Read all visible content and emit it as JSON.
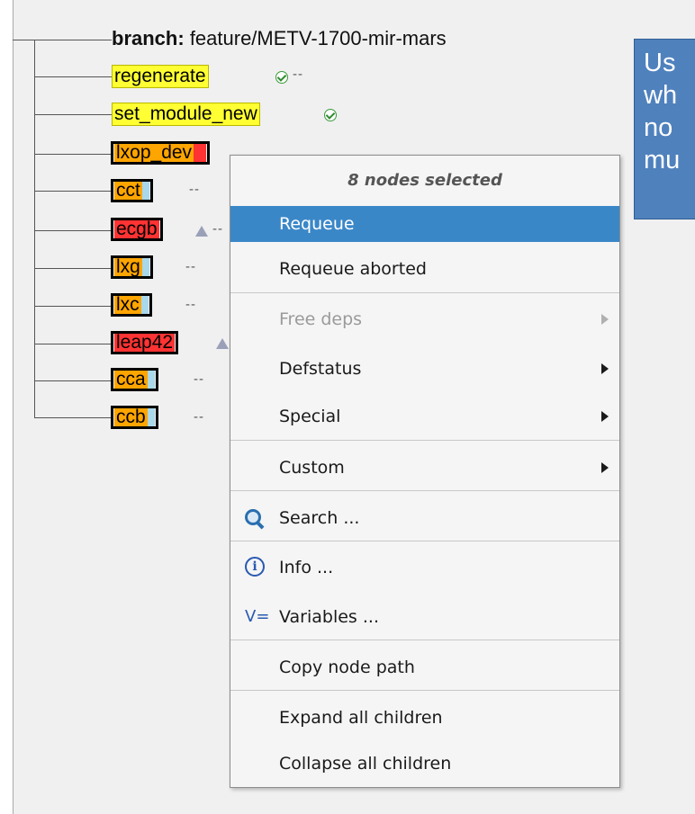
{
  "tree": {
    "branch_key": "branch:",
    "branch_value": "feature/METV-1700-mir-mars",
    "nodes": [
      {
        "label": "regenerate",
        "style": "yellow"
      },
      {
        "label": "set_module_new",
        "style": "yellow"
      },
      {
        "label": "lxop_dev",
        "style": "orange"
      },
      {
        "label": "cct",
        "style": "orange"
      },
      {
        "label": "ecgb",
        "style": "red"
      },
      {
        "label": "lxg",
        "style": "orange"
      },
      {
        "label": "lxc",
        "style": "orange"
      },
      {
        "label": "leap42",
        "style": "red"
      },
      {
        "label": "cca",
        "style": "orange"
      },
      {
        "label": "ccb",
        "style": "orange"
      }
    ],
    "dashes": "--"
  },
  "tooltip": {
    "lines": [
      "Us",
      "wh",
      "no",
      "mu"
    ]
  },
  "context_menu": {
    "header": "8 nodes selected",
    "items": {
      "requeue": "Requeue",
      "requeue_aborted": "Requeue aborted",
      "free_deps": "Free deps",
      "defstatus": "Defstatus",
      "special": "Special",
      "custom": "Custom",
      "search": "Search ...",
      "info": "Info ...",
      "variables": "Variables ...",
      "copy_node_path": "Copy node path",
      "expand_all": "Expand all children",
      "collapse_all": "Collapse all children"
    },
    "variables_icon_text": "V="
  },
  "colors": {
    "highlight": "#3a87c8",
    "tooltip": "#4f81bd",
    "yellow_node": "#ffff33",
    "orange_node": "#ffa500",
    "red_node": "#ff3333"
  }
}
